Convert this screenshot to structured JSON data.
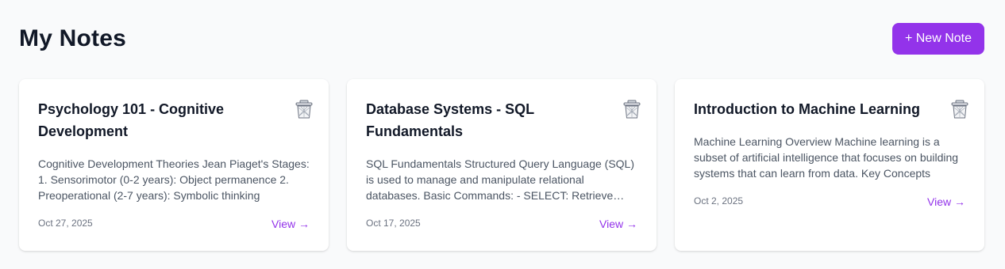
{
  "header": {
    "title": "My Notes",
    "new_note_label": "+ New Note"
  },
  "colors": {
    "accent": "#9333ea",
    "background": "#f9fafb"
  },
  "notes": [
    {
      "title": "Psychology 101 - Cognitive Development",
      "preview": "Cognitive Development Theories Jean Piaget's Stages: 1. Sensorimotor (0-2 years): Object permanence 2. Preoperational (2-7 years): Symbolic thinking",
      "date": "Oct 27, 2025",
      "view_label": "View →",
      "delete_icon": "trash-icon"
    },
    {
      "title": "Database Systems - SQL Fundamentals",
      "preview": "SQL Fundamentals Structured Query Language (SQL) is used to manage and manipulate relational databases. Basic Commands: - SELECT: Retrieve data",
      "date": "Oct 17, 2025",
      "view_label": "View →",
      "delete_icon": "trash-icon"
    },
    {
      "title": "Introduction to Machine Learning",
      "preview": "Machine Learning Overview Machine learning is a subset of artificial intelligence that focuses on building systems that can learn from data. Key Concepts",
      "date": "Oct 2, 2025",
      "view_label": "View →",
      "delete_icon": "trash-icon"
    }
  ]
}
